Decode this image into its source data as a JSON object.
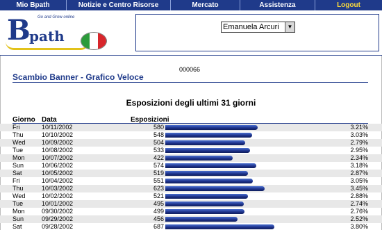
{
  "nav": [
    {
      "label": "Mio Bpath"
    },
    {
      "label": "Notizie e Centro Risorse"
    },
    {
      "label": "Mercato"
    },
    {
      "label": "Assistenza"
    },
    {
      "label": "Logout"
    }
  ],
  "logo": {
    "letter": "B",
    "rest": "path",
    "tagline": "Go and Grow online"
  },
  "user": {
    "selected": "Emanuela Arcuri"
  },
  "page": {
    "doc_id": "000066",
    "title": "Scambio Banner - Grafico Veloce",
    "chart_title": "Esposizioni degli ultimi 31 giorni"
  },
  "columns": {
    "day": "Giorno",
    "date": "Data",
    "value": "Esposizioni"
  },
  "chart_data": {
    "type": "bar",
    "title": "Esposizioni degli ultimi 31 giorni",
    "categories": [
      "10/11/2002",
      "10/10/2002",
      "10/09/2002",
      "10/08/2002",
      "10/07/2002",
      "10/06/2002",
      "10/05/2002",
      "10/04/2002",
      "10/03/2002",
      "10/02/2002",
      "10/01/2002",
      "09/30/2002",
      "09/29/2002",
      "09/28/2002"
    ],
    "days": [
      "Fri",
      "Thu",
      "Wed",
      "Tue",
      "Mon",
      "Sun",
      "Sat",
      "Fri",
      "Thu",
      "Wed",
      "Tue",
      "Mon",
      "Sun",
      "Sat"
    ],
    "values": [
      580,
      548,
      504,
      533,
      422,
      574,
      519,
      551,
      623,
      521,
      495,
      499,
      456,
      687
    ],
    "percents": [
      "3.21%",
      "3.03%",
      "2.79%",
      "2.95%",
      "2.34%",
      "3.18%",
      "2.87%",
      "3.05%",
      "3.45%",
      "2.88%",
      "2.74%",
      "2.76%",
      "2.52%",
      "3.80%"
    ]
  }
}
